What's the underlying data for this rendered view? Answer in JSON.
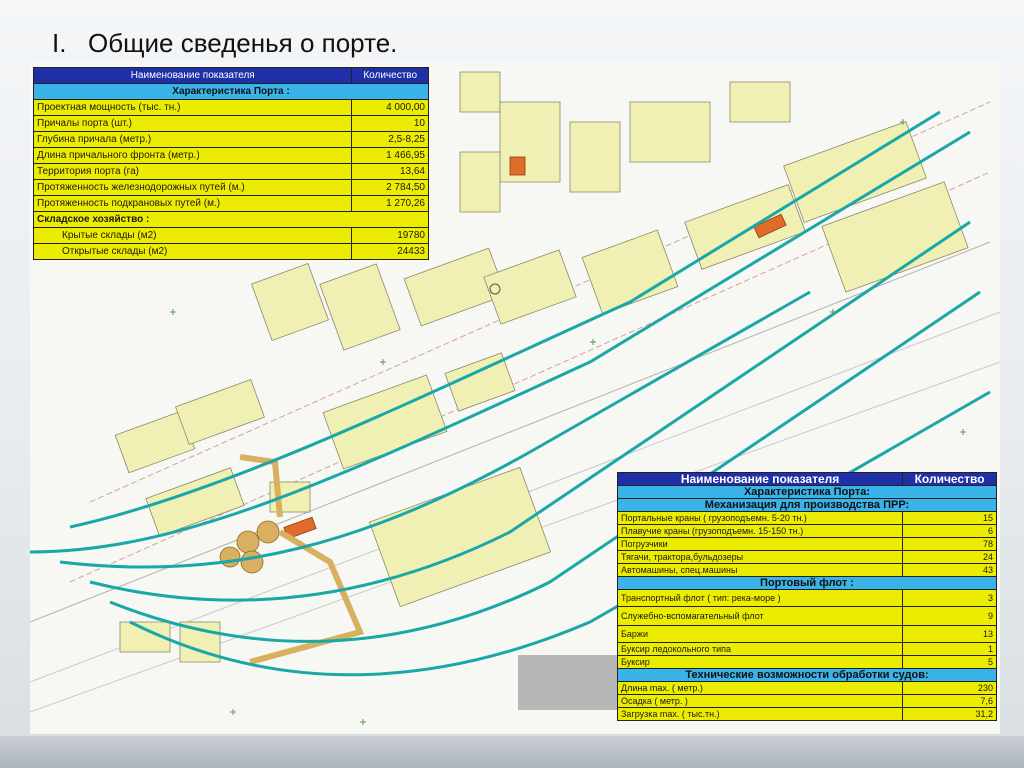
{
  "slide": {
    "number": "I.",
    "title": "Общие сведенья о порте."
  },
  "colors": {
    "table_header": "#1f2fa8",
    "table_section": "#3ab3e8",
    "table_row": "#ecec00",
    "rail": "#1aa7a7",
    "building": "#f1f0b4",
    "accent_building": "#e06b2a"
  },
  "table1": {
    "col_name": "Наименование показателя",
    "col_qty": "Количество",
    "section": "Характеристика Порта :",
    "rows": [
      {
        "label": "Проектная мощность (тыс. тн.)",
        "value": "4 000,00"
      },
      {
        "label": "Причалы порта (шт.)",
        "value": "10"
      },
      {
        "label": "Глубина причала (метр.)",
        "value": "2,5-8,25"
      },
      {
        "label": "Длина причального фронта (метр.)",
        "value": "1 466,95"
      },
      {
        "label": "Территория порта (га)",
        "value": "13,64"
      },
      {
        "label": "Протяженность железнодорожных путей (м.)",
        "value": "2 784,50"
      },
      {
        "label": "Протяженность подкрановых путей (м.)",
        "value": "1 270,26"
      }
    ],
    "storage_label": "Складское хозяйство :",
    "storage_rows": [
      {
        "label": "Крытые склады (м2)",
        "value": "19780"
      },
      {
        "label": "Открытые склады (м2)",
        "value": "24433"
      }
    ]
  },
  "table2": {
    "col_name": "Наименование показателя",
    "col_qty": "Количество",
    "section_main": "Характеристика Порта:",
    "section_mech": "Механизация для производства ПРР:",
    "mech_rows": [
      {
        "label": "Портальные краны ( грузоподъемн. 5-20 тн.)",
        "value": "15"
      },
      {
        "label": "Плавучие краны (грузоподъемн. 15-150 тн.)",
        "value": "6"
      },
      {
        "label": "Погрузчики",
        "value": "78"
      },
      {
        "label": "Тягачи, трактора,бульдозеры",
        "value": "24"
      },
      {
        "label": "Автомашины, спец.машины",
        "value": "43"
      }
    ],
    "section_fleet": "Портовый флот :",
    "fleet_rows": [
      {
        "label": "Транспортный флот ( тип: река-море )",
        "value": "3"
      },
      {
        "label": "Служебно-вспомагательный флот",
        "value": "9"
      },
      {
        "label": "Баржи",
        "value": "13"
      },
      {
        "label": "Буксир ледокольного типа",
        "value": "1"
      },
      {
        "label": "Буксир",
        "value": "5"
      }
    ],
    "section_tech": "Технические возможности обработки судов:",
    "tech_rows": [
      {
        "label": "Длина max. ( метр.)",
        "value": "230"
      },
      {
        "label": "Осадка ( метр. )",
        "value": "7,6"
      },
      {
        "label": "Загрузка max. ( тыс.тн.)",
        "value": "31,2"
      }
    ]
  }
}
